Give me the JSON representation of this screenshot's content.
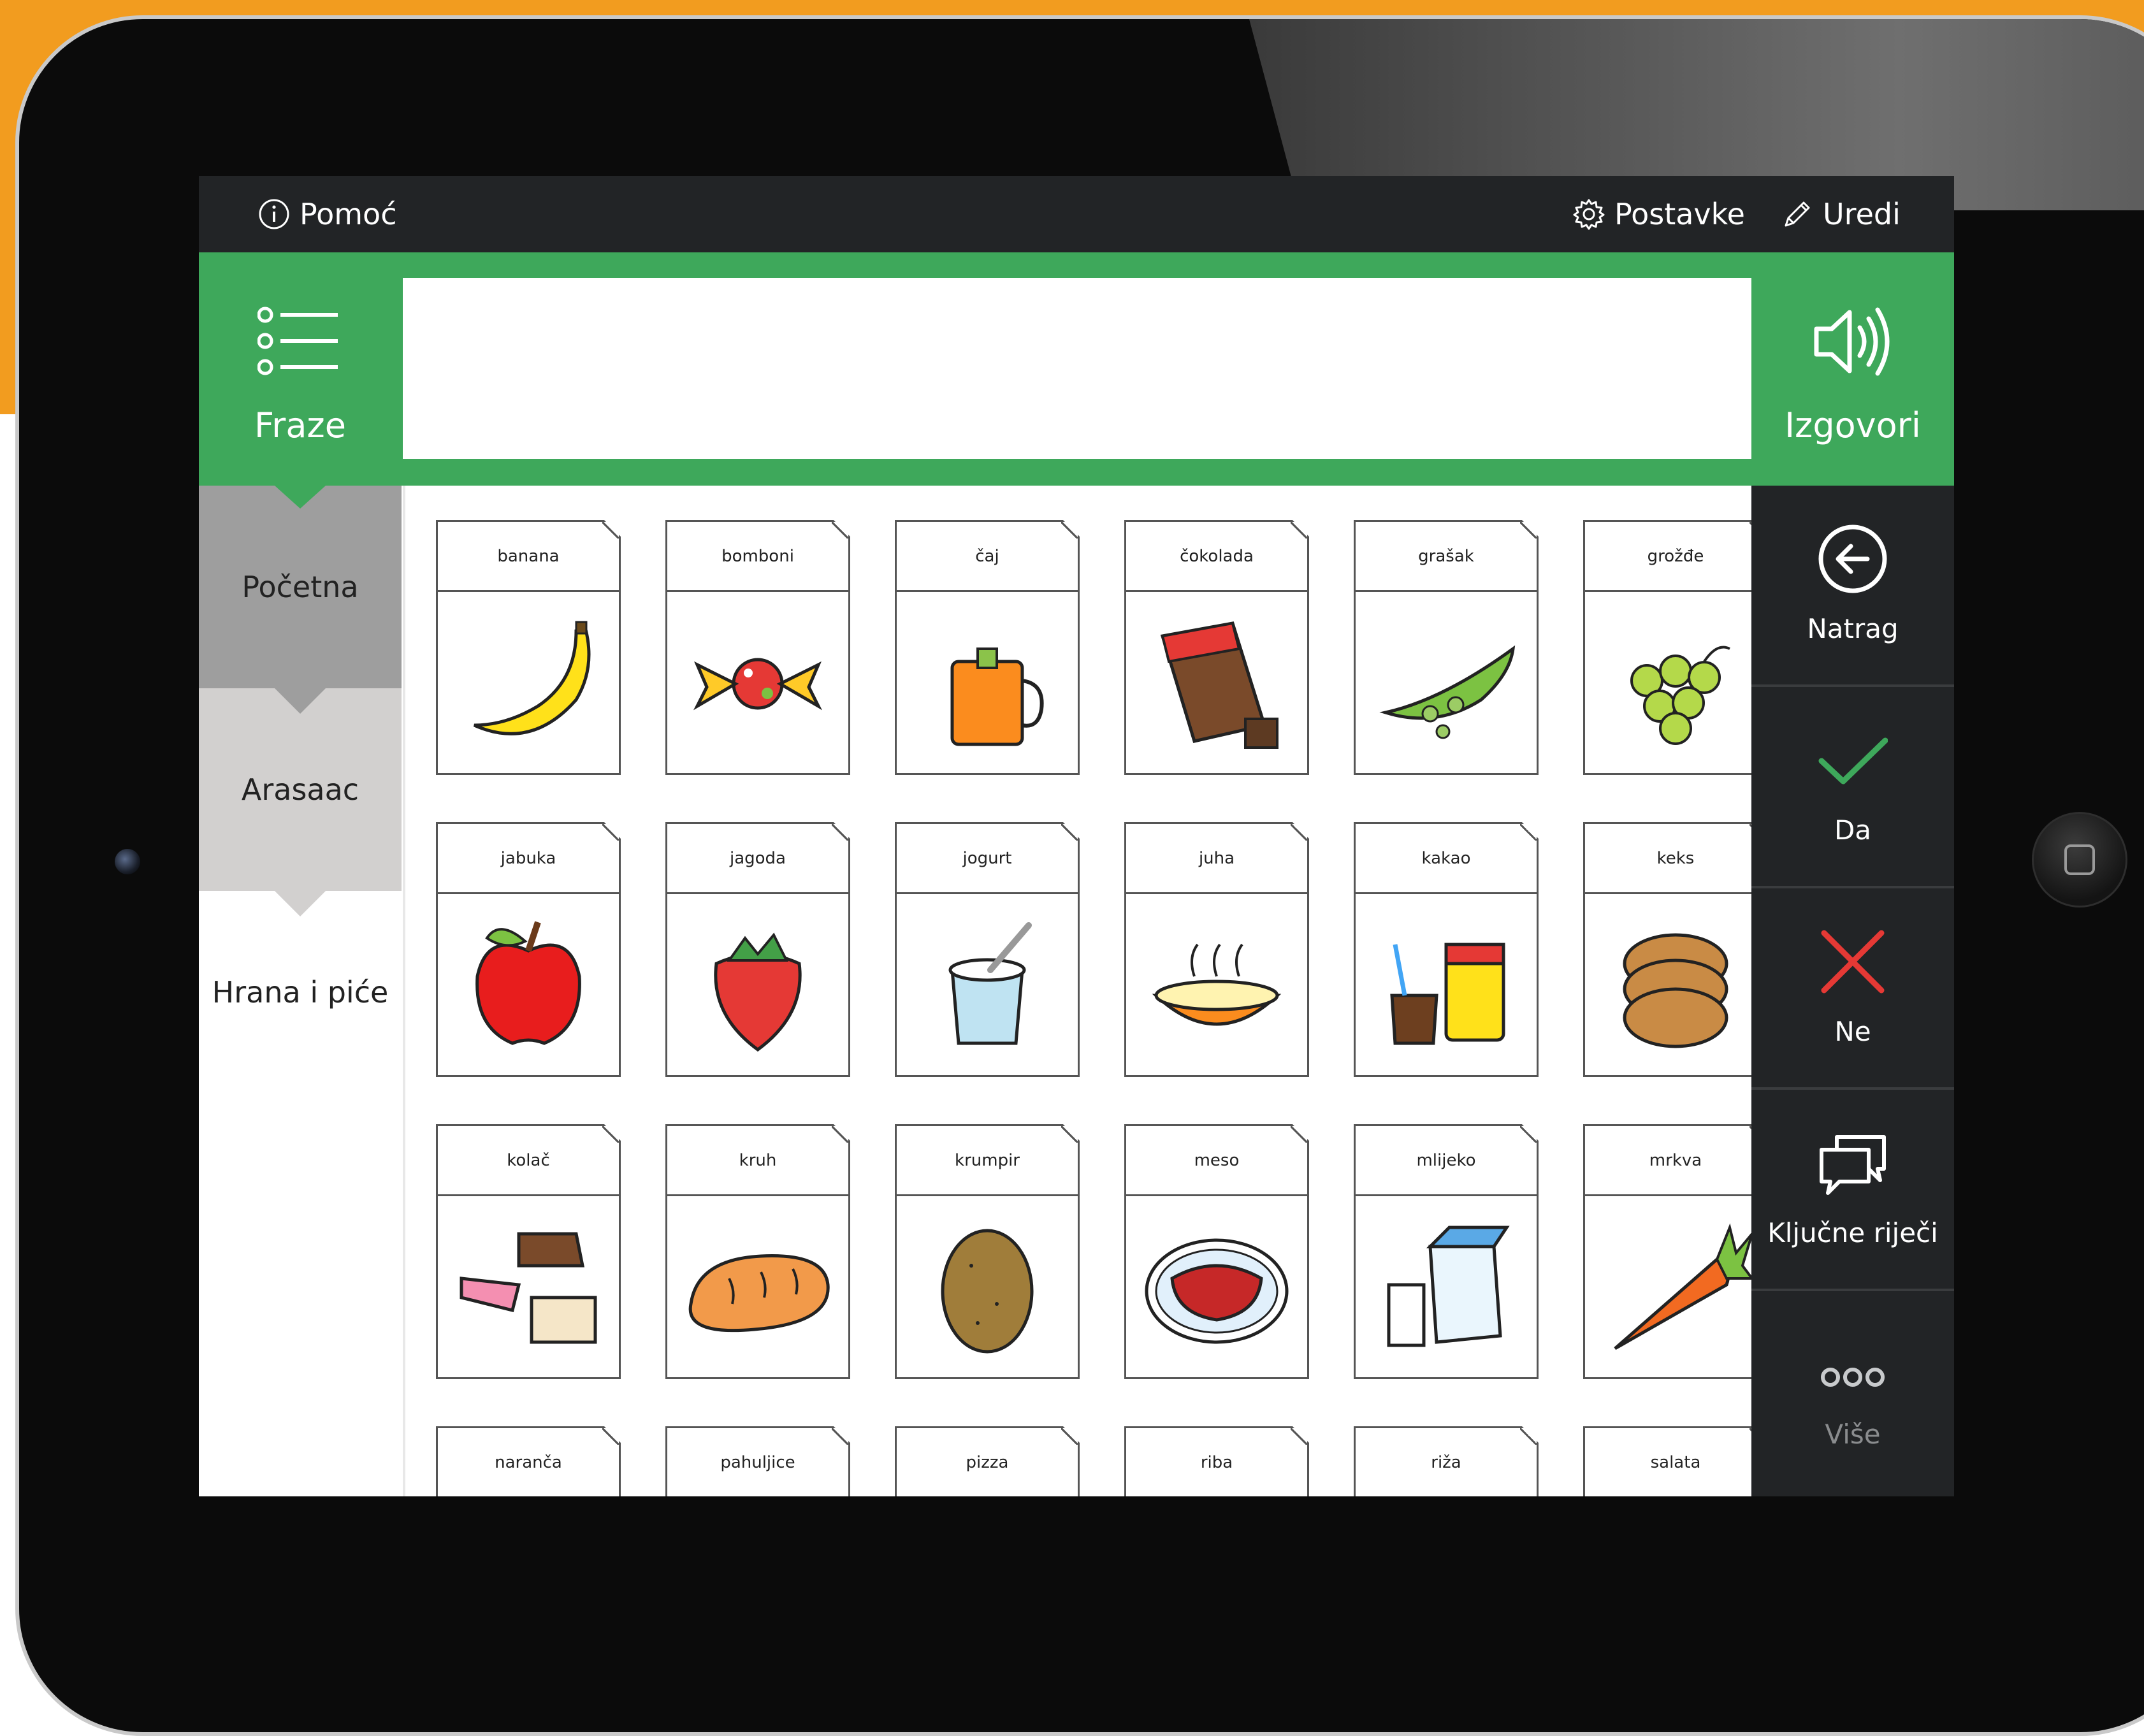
{
  "colors": {
    "accent_green": "#3ea85b",
    "dark_bar": "#222426",
    "device_bg": "#f29c1f"
  },
  "topbar": {
    "help_label": "Pomoć",
    "settings_label": "Postavke",
    "edit_label": "Uredi"
  },
  "greenbar": {
    "phrases_label": "Fraze",
    "speak_label": "Izgovori",
    "message_text": ""
  },
  "nav": {
    "items": [
      {
        "label": "Početna"
      },
      {
        "label": "Arasaac"
      },
      {
        "label": "Hrana i piće"
      }
    ]
  },
  "grid": {
    "cards": [
      {
        "label": "banana",
        "icon": "banana-icon"
      },
      {
        "label": "bomboni",
        "icon": "candy-icon"
      },
      {
        "label": "čaj",
        "icon": "tea-icon"
      },
      {
        "label": "čokolada",
        "icon": "chocolate-icon"
      },
      {
        "label": "grašak",
        "icon": "peas-icon"
      },
      {
        "label": "grožđe",
        "icon": "grapes-icon"
      },
      {
        "label": "jabuka",
        "icon": "apple-icon"
      },
      {
        "label": "jagoda",
        "icon": "strawberry-icon"
      },
      {
        "label": "jogurt",
        "icon": "yogurt-icon"
      },
      {
        "label": "juha",
        "icon": "soup-icon"
      },
      {
        "label": "kakao",
        "icon": "cocoa-icon"
      },
      {
        "label": "keks",
        "icon": "cookie-icon"
      },
      {
        "label": "kolač",
        "icon": "cake-icon"
      },
      {
        "label": "kruh",
        "icon": "bread-icon"
      },
      {
        "label": "krumpir",
        "icon": "potato-icon"
      },
      {
        "label": "meso",
        "icon": "meat-icon"
      },
      {
        "label": "mlijeko",
        "icon": "milk-icon"
      },
      {
        "label": "mrkva",
        "icon": "carrot-icon"
      },
      {
        "label": "naranča",
        "icon": "orange-icon"
      },
      {
        "label": "pahuljice",
        "icon": "cereal-icon"
      },
      {
        "label": "pizza",
        "icon": "pizza-icon"
      },
      {
        "label": "riba",
        "icon": "fish-icon"
      },
      {
        "label": "riža",
        "icon": "rice-icon"
      },
      {
        "label": "salata",
        "icon": "salad-icon"
      }
    ]
  },
  "rightnav": {
    "back_label": "Natrag",
    "yes_label": "Da",
    "no_label": "Ne",
    "keywords_label": "Ključne riječi",
    "more_label": "Više"
  }
}
